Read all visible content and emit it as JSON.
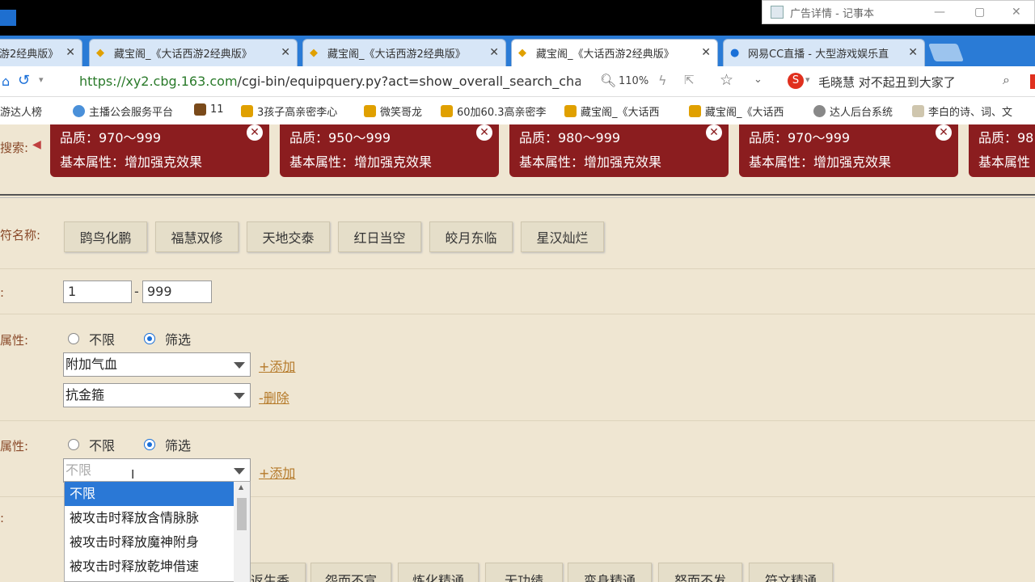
{
  "notepad": {
    "title": "广告详情 - 记事本"
  },
  "tabs": [
    {
      "label": "游2经典版》",
      "active": false
    },
    {
      "label": "藏宝阁_《大话西游2经典版》",
      "active": false
    },
    {
      "label": "藏宝阁_《大话西游2经典版》",
      "active": false
    },
    {
      "label": "藏宝阁_《大话西游2经典版》",
      "active": true
    },
    {
      "label": "网易CC直播 - 大型游戏娱乐直",
      "active": false
    }
  ],
  "address": {
    "url_host": "https://xy2.cbg.163.com",
    "url_rest": "/cgi-bin/equipquery.py?act=show_overall_search_charm",
    "zoom": "110%",
    "search_hint": "毛晓慧 对不起丑到大家了"
  },
  "bookmarks": [
    "游达人榜",
    "主播公会服务平台",
    "11",
    "3孩子高亲密李心",
    "微笑哥龙",
    "60加60.3高亲密李",
    "藏宝阁_《大话西",
    "藏宝阁_《大话西",
    "达人后台系统",
    "李白的诗、词、文"
  ],
  "chips": [
    {
      "quality": "品质：970～999",
      "attr": "基本属性：增加强克效果"
    },
    {
      "quality": "品质：950～999",
      "attr": "基本属性：增加强克效果"
    },
    {
      "quality": "品质：980～999",
      "attr": "基本属性：增加强克效果"
    },
    {
      "quality": "品质：970～999",
      "attr": "基本属性：增加强克效果"
    },
    {
      "quality": "品质：98",
      "attr": "基本属性"
    }
  ],
  "labels": {
    "search": "搜索:",
    "fuwen_name": "符名称:",
    "level": ":",
    "attr1": "属性:",
    "attr2": "属性:",
    "row4": ":"
  },
  "fuwen_options": [
    "鹍鸟化鹏",
    "福慧双修",
    "天地交泰",
    "红日当空",
    "皎月东临",
    "星汉灿烂"
  ],
  "range": {
    "min": "1",
    "max": "999",
    "dash": "-"
  },
  "section1": {
    "radio_unlimited": "不限",
    "radio_filter": "筛选",
    "select1": "附加气血",
    "select2": "抗金箍",
    "add": "+添加",
    "remove": "-删除"
  },
  "section2": {
    "radio_unlimited": "不限",
    "radio_filter": "筛选",
    "select_placeholder": "不限",
    "add": "+添加",
    "options": [
      "不限",
      "被攻击时释放含情脉脉",
      "被攻击时释放魔神附身",
      "被攻击时释放乾坤借速"
    ]
  },
  "bottom_buttons": [
    "返生香",
    "怨而不宣",
    "炼化精通",
    "无功绩",
    "变身精通",
    "怒而不发",
    "符文精通"
  ]
}
